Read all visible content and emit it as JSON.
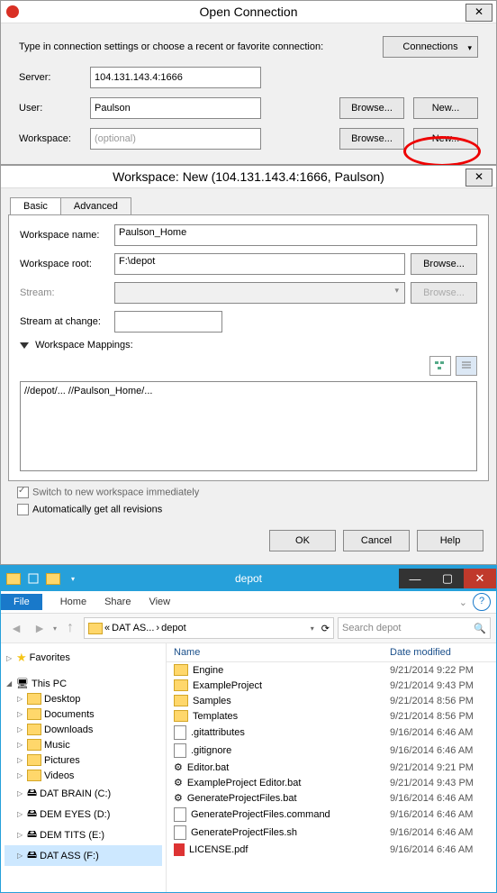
{
  "open_connection": {
    "title": "Open Connection",
    "instruction": "Type in connection settings or choose a recent or favorite connection:",
    "connections_label": "Connections",
    "server_label": "Server:",
    "server_value": "104.131.143.4:1666",
    "user_label": "User:",
    "user_value": "Paulson",
    "workspace_label": "Workspace:",
    "workspace_placeholder": "(optional)",
    "browse_label": "Browse...",
    "new_label": "New..."
  },
  "workspace_new": {
    "title": "Workspace: New (104.131.143.4:1666, Paulson)",
    "tabs": {
      "basic": "Basic",
      "advanced": "Advanced"
    },
    "name_label": "Workspace name:",
    "name_value": "Paulson_Home",
    "root_label": "Workspace root:",
    "root_value": "F:\\depot",
    "browse_label": "Browse...",
    "stream_label": "Stream:",
    "stream_at_change_label": "Stream at change:",
    "mappings_label": "Workspace Mappings:",
    "mappings_value": "//depot/... //Paulson_Home/...",
    "switch_label": "Switch to new workspace immediately",
    "auto_label": "Automatically get all revisions",
    "buttons": {
      "ok": "OK",
      "cancel": "Cancel",
      "help": "Help"
    }
  },
  "explorer": {
    "title": "depot",
    "ribbon": {
      "file": "File",
      "home": "Home",
      "share": "Share",
      "view": "View"
    },
    "breadcrumb": [
      "«",
      "DAT AS...",
      "›",
      "depot"
    ],
    "search_placeholder": "Search depot",
    "tree": {
      "favorites": "Favorites",
      "thispc": "This PC",
      "items": [
        "Desktop",
        "Documents",
        "Downloads",
        "Music",
        "Pictures",
        "Videos",
        "DAT BRAIN (C:)",
        "DEM EYES (D:)",
        "DEM TITS (E:)",
        "DAT ASS (F:)"
      ]
    },
    "columns": {
      "name": "Name",
      "modified": "Date modified"
    },
    "files": [
      {
        "name": "Engine",
        "type": "folder",
        "modified": "9/21/2014 9:22 PM"
      },
      {
        "name": "ExampleProject",
        "type": "folder",
        "modified": "9/21/2014 9:43 PM"
      },
      {
        "name": "Samples",
        "type": "folder",
        "modified": "9/21/2014 8:56 PM"
      },
      {
        "name": "Templates",
        "type": "folder",
        "modified": "9/21/2014 8:56 PM"
      },
      {
        "name": ".gitattributes",
        "type": "file",
        "modified": "9/16/2014 6:46 AM"
      },
      {
        "name": ".gitignore",
        "type": "file",
        "modified": "9/16/2014 6:46 AM"
      },
      {
        "name": "Editor.bat",
        "type": "bat",
        "modified": "9/21/2014 9:21 PM"
      },
      {
        "name": "ExampleProject Editor.bat",
        "type": "bat",
        "modified": "9/21/2014 9:43 PM"
      },
      {
        "name": "GenerateProjectFiles.bat",
        "type": "bat",
        "modified": "9/16/2014 6:46 AM"
      },
      {
        "name": "GenerateProjectFiles.command",
        "type": "file",
        "modified": "9/16/2014 6:46 AM"
      },
      {
        "name": "GenerateProjectFiles.sh",
        "type": "file",
        "modified": "9/16/2014 6:46 AM"
      },
      {
        "name": "LICENSE.pdf",
        "type": "pdf",
        "modified": "9/16/2014 6:46 AM"
      }
    ]
  }
}
